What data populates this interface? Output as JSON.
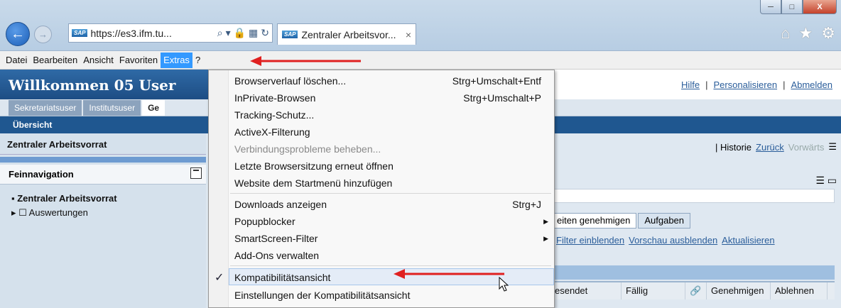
{
  "window": {
    "minimize": "─",
    "maximize": "□",
    "close": "X"
  },
  "browser": {
    "url": "https://es3.ifm.tu...",
    "tab_title": "Zentraler Arbeitsvor...",
    "tab_close": "×"
  },
  "menubar": {
    "items": [
      "Datei",
      "Bearbeiten",
      "Ansicht",
      "Favoriten",
      "Extras",
      "?"
    ]
  },
  "sap": {
    "welcome": "Willkommen 05 User",
    "links": [
      "Hilfe",
      "Personalisieren",
      "Abmelden"
    ],
    "tabs": [
      "Sekretariatsuser",
      "Institutsuser",
      "Ge"
    ],
    "subnav": "Übersicht",
    "left_title": "Zentraler Arbeitsvorrat",
    "feinnav": "Feinnavigation",
    "nav_items": [
      "▪ Zentraler Arbeitsvorrat",
      "▸ ☐ Auswertungen"
    ],
    "history": [
      "| Historie",
      "Zurück",
      "Vorwärts"
    ],
    "subtabs": [
      "eiten genehmigen",
      "Aufgaben"
    ],
    "filters": [
      "Filter einblenden",
      "Vorschau ausblenden",
      "Aktualisieren"
    ],
    "table_headers": [
      "esendet",
      "Fällig",
      "🔗",
      "Genehmigen",
      "Ablehnen"
    ]
  },
  "extras_menu": {
    "group1": [
      {
        "label": "Browserverlauf löschen...",
        "shortcut": "Strg+Umschalt+Entf"
      },
      {
        "label": "InPrivate-Browsen",
        "shortcut": "Strg+Umschalt+P"
      },
      {
        "label": "Tracking-Schutz...",
        "shortcut": ""
      },
      {
        "label": "ActiveX-Filterung",
        "shortcut": ""
      },
      {
        "label": "Verbindungsprobleme beheben...",
        "shortcut": ""
      },
      {
        "label": "Letzte Browsersitzung erneut öffnen",
        "shortcut": ""
      },
      {
        "label": "Website dem Startmenü hinzufügen",
        "shortcut": ""
      }
    ],
    "group2": [
      {
        "label": "Downloads anzeigen",
        "shortcut": "Strg+J"
      },
      {
        "label": "Popupblocker",
        "shortcut": ""
      },
      {
        "label": "SmartScreen-Filter",
        "shortcut": ""
      },
      {
        "label": "Add-Ons verwalten",
        "shortcut": ""
      }
    ],
    "group3": [
      {
        "label": "Kompatibilitätsansicht",
        "checked": "✓"
      },
      {
        "label": "Einstellungen der Kompatibilitätsansicht"
      }
    ]
  },
  "colors": {
    "annotation_arrow": "#e02020",
    "menu_highlight": "#3399ff",
    "sap_header": "#1d4d84"
  }
}
